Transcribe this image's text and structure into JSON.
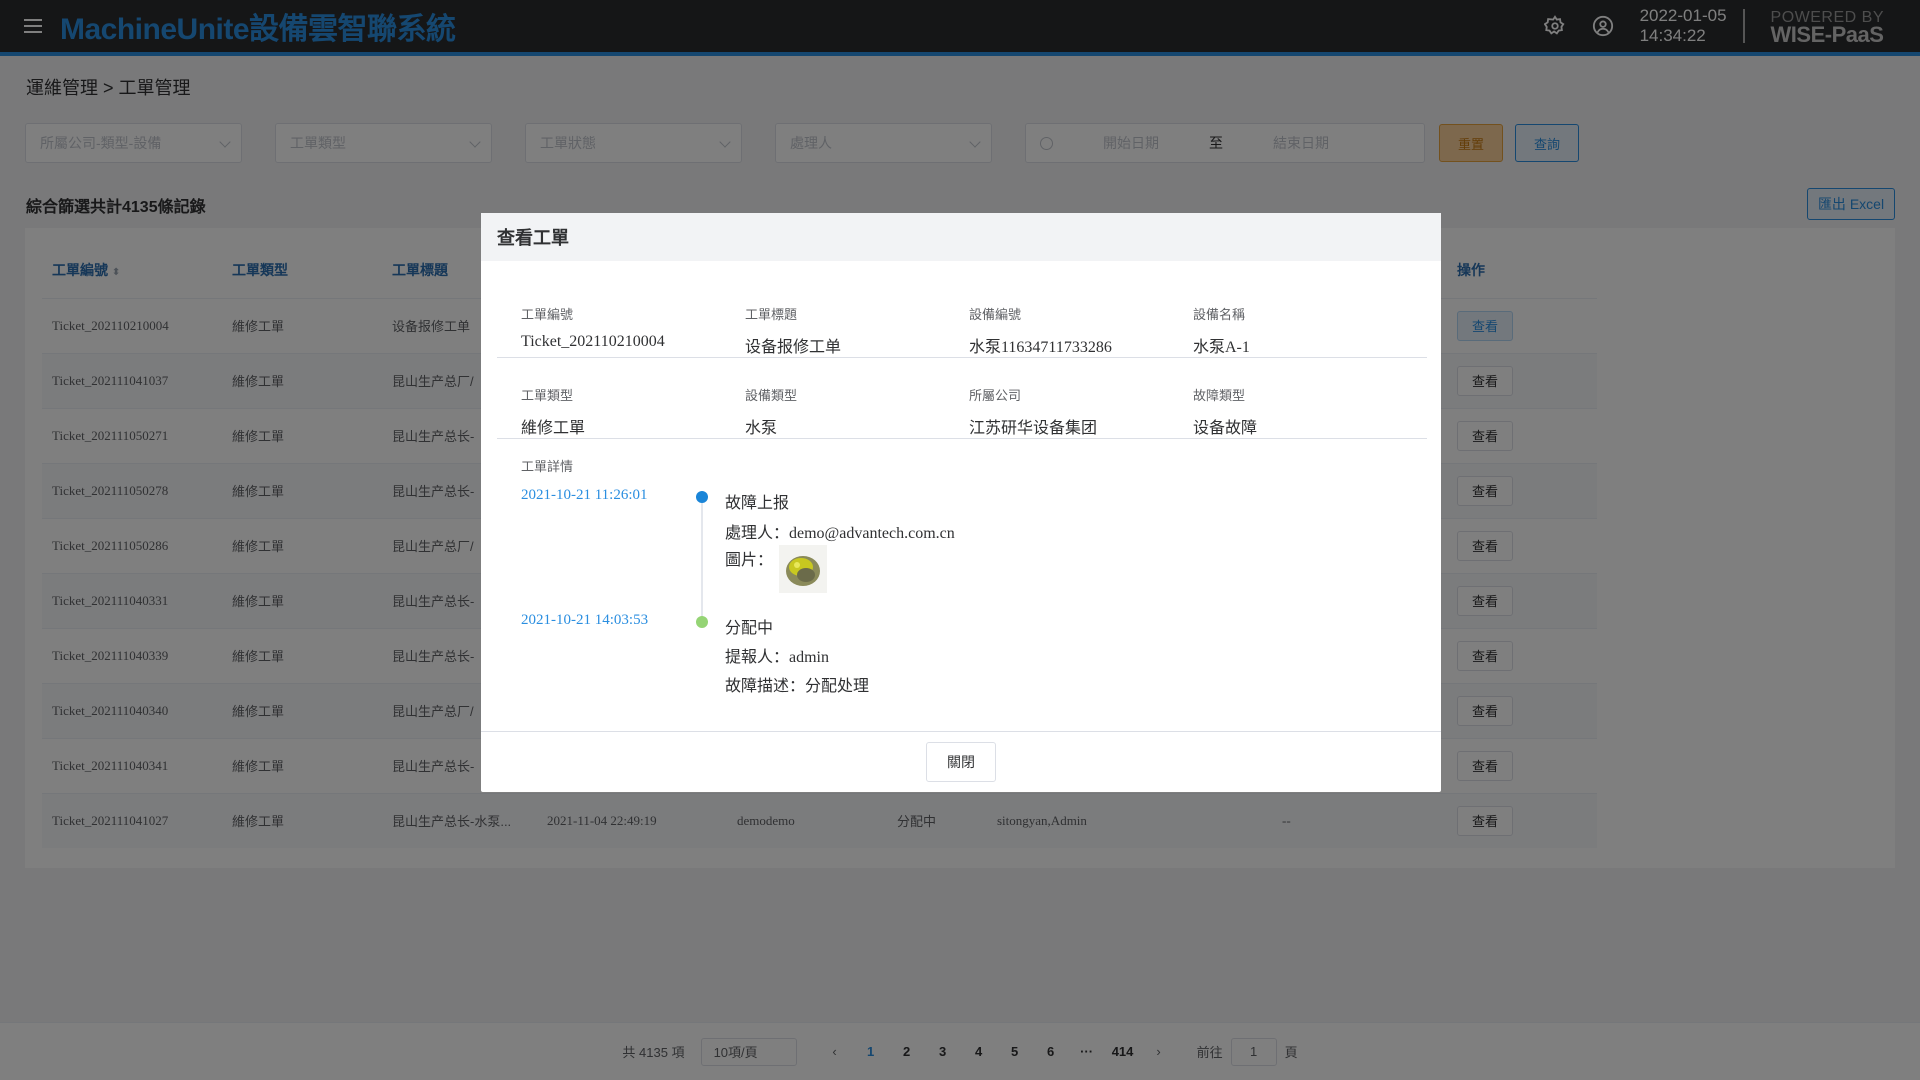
{
  "header": {
    "brand": "MachineUnite設備雲智聯系統",
    "date": "2022-01-05",
    "time": "14:34:22",
    "powered_line1": "POWERED BY",
    "powered_line2": "WISE-PaaS",
    "accent": "#2a8ee0"
  },
  "breadcrumb": "運維管理 > 工單管理",
  "filters": {
    "company_placeholder": "所屬公司-類型-設備",
    "type_placeholder": "工單類型",
    "status_placeholder": "工單狀態",
    "handler_placeholder": "處理人",
    "start_date_placeholder": "開始日期",
    "date_sep": "至",
    "end_date_placeholder": "結束日期",
    "reset_label": "重置",
    "search_label": "查詢"
  },
  "summary": "綜合篩選共計4135條記錄",
  "export_label": "匯出 Excel",
  "table": {
    "headers": [
      "工單編號",
      "工單類型",
      "工單標題",
      "",
      "",
      "",
      "",
      "",
      "操作"
    ],
    "view_label": "查看",
    "rows": [
      {
        "id": "Ticket_202110210004",
        "type": "維修工單",
        "title": "设备报修工单",
        "time": "",
        "creator": "",
        "status": "",
        "handler": "",
        "extra": ""
      },
      {
        "id": "Ticket_202111041037",
        "type": "維修工單",
        "title": "昆山生产总厂/",
        "time": "",
        "creator": "",
        "status": "",
        "handler": "",
        "extra": ""
      },
      {
        "id": "Ticket_202111050271",
        "type": "維修工單",
        "title": "昆山生产总长-",
        "time": "",
        "creator": "",
        "status": "",
        "handler": "",
        "extra": ""
      },
      {
        "id": "Ticket_202111050278",
        "type": "維修工單",
        "title": "昆山生产总长-",
        "time": "",
        "creator": "",
        "status": "",
        "handler": "",
        "extra": ""
      },
      {
        "id": "Ticket_202111050286",
        "type": "維修工單",
        "title": "昆山生产总厂/",
        "time": "",
        "creator": "",
        "status": "",
        "handler": "",
        "extra": ""
      },
      {
        "id": "Ticket_202111040331",
        "type": "維修工單",
        "title": "昆山生产总长-",
        "time": "",
        "creator": "",
        "status": "",
        "handler": "",
        "extra": ""
      },
      {
        "id": "Ticket_202111040339",
        "type": "維修工單",
        "title": "昆山生产总长-",
        "time": "",
        "creator": "",
        "status": "",
        "handler": "",
        "extra": ""
      },
      {
        "id": "Ticket_202111040340",
        "type": "維修工單",
        "title": "昆山生产总厂/",
        "time": "",
        "creator": "",
        "status": "",
        "handler": "",
        "extra": ""
      },
      {
        "id": "Ticket_202111040341",
        "type": "維修工單",
        "title": "昆山生产总长-",
        "time": "",
        "creator": "",
        "status": "",
        "handler": "",
        "extra": ""
      },
      {
        "id": "Ticket_202111041027",
        "type": "維修工單",
        "title": "昆山生产总长-水泵...",
        "time": "2021-11-04 22:49:19",
        "creator": "demodemo",
        "status": "分配中",
        "handler": "sitongyan,Admin",
        "extra": "--"
      }
    ]
  },
  "pagination": {
    "total": "共 4135 項",
    "per_page": "10項/頁",
    "pages": [
      "1",
      "2",
      "3",
      "4",
      "5",
      "6",
      "···",
      "414"
    ],
    "current": "1",
    "goto_label": "前往",
    "goto_value": "1",
    "page_suffix": "頁"
  },
  "modal": {
    "title": "查看工單",
    "fields_row1": [
      {
        "label": "工單編號",
        "value": "Ticket_202110210004"
      },
      {
        "label": "工單標題",
        "value": "设备报修工单"
      },
      {
        "label": "設備編號",
        "value": "水泵11634711733286"
      },
      {
        "label": "設備名稱",
        "value": "水泵A-1"
      }
    ],
    "fields_row2": [
      {
        "label": "工單類型",
        "value": "維修工單"
      },
      {
        "label": "設備類型",
        "value": "水泵"
      },
      {
        "label": "所屬公司",
        "value": "江苏研华设备集团"
      },
      {
        "label": "故障類型",
        "value": "设备故障"
      }
    ],
    "detail_label": "工單詳情",
    "timeline": [
      {
        "time": "2021-10-21 11:26:01",
        "status": "故障上报",
        "line1": "處理人：demo@advantech.com.cn",
        "line2": "圖片：",
        "dot_color": "#1a85d8"
      },
      {
        "time": "2021-10-21 14:03:53",
        "status": "分配中",
        "line1": "提報人：admin",
        "line2": "故障描述：分配处理",
        "dot_color": "#95d475"
      }
    ],
    "close_label": "關閉"
  }
}
